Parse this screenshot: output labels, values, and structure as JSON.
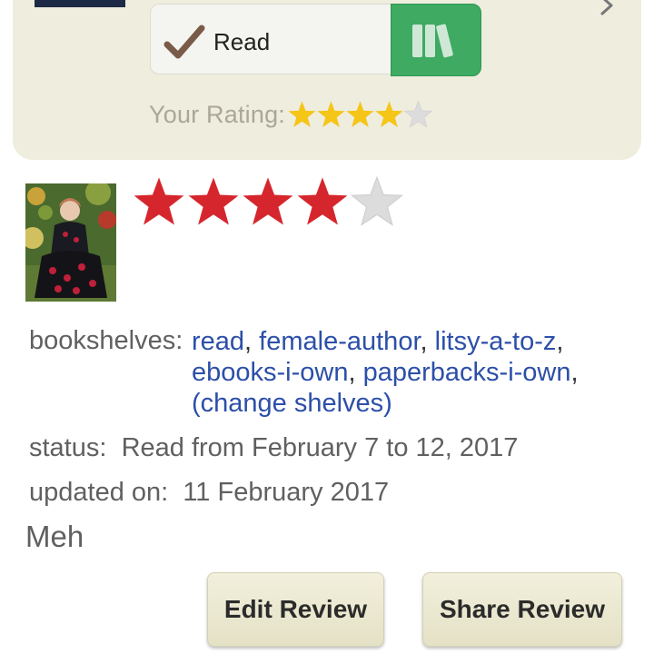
{
  "colors": {
    "card_bg": "#eeedde",
    "shelf_button_green": "#3eaa62",
    "link_blue": "#2c4fa8",
    "rating_star_gold": "#f5c518",
    "review_star_red": "#d6262d",
    "empty_star_gray": "#dcdcdc"
  },
  "shelf_status": {
    "read_label": "Read",
    "check_icon": "checkmark-icon",
    "shelf_icon": "bookshelf-icon"
  },
  "your_rating": {
    "label": "Your Rating:",
    "stars": 4,
    "max": 5
  },
  "review": {
    "stars": 4,
    "max": 5,
    "bookshelves_label": "bookshelves:",
    "shelves": [
      "read",
      "female-author",
      "litsy-a-to-z",
      "ebooks-i-own",
      "paperbacks-i-own"
    ],
    "change_shelves": "(change shelves)",
    "status_label": "status:",
    "status_value": "Read from February 7 to 12, 2017",
    "updated_label": "updated on:",
    "updated_value": "11 February 2017",
    "text": "Meh"
  },
  "actions": {
    "edit_label": "Edit Review",
    "share_label": "Share Review"
  }
}
